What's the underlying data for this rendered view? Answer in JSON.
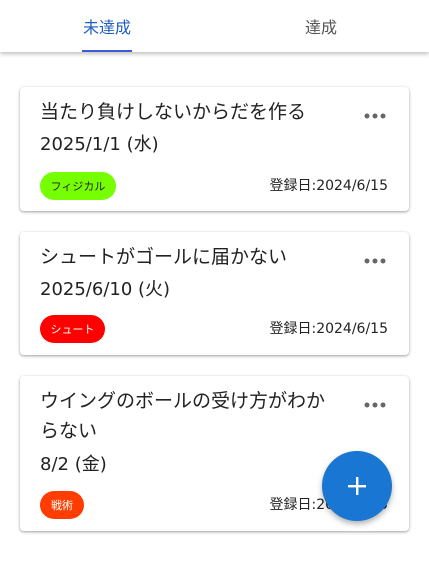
{
  "tabs": [
    {
      "label": "未達成",
      "active": true
    },
    {
      "label": "達成",
      "active": false
    }
  ],
  "colors": {
    "active_tab": "#1f5fbf",
    "indicator": "#3b5bdb",
    "fab": "#1976d2",
    "tag_physical": "#76ff03",
    "tag_shoot": "#ff0000",
    "tag_tactics": "#ff3d00"
  },
  "cards": [
    {
      "title": "当たり負けしないからだを作る",
      "date": "2025/1/1 (水)",
      "tag": "フィジカル",
      "registered": "登録日:2024/6/15",
      "more_icon": "more-horiz-icon"
    },
    {
      "title": "シュートがゴールに届かない",
      "date": "2025/6/10 (火)",
      "tag": "シュート",
      "registered": "登録日:2024/6/15",
      "more_icon": "more-horiz-icon"
    },
    {
      "title": "ウイングのボールの受け方がわからない",
      "date": "8/2 (金)",
      "tag": "戦術",
      "registered": "登録日:2024/6/15",
      "more_icon": "more-horiz-icon"
    }
  ],
  "fab": {
    "icon": "plus-icon"
  }
}
